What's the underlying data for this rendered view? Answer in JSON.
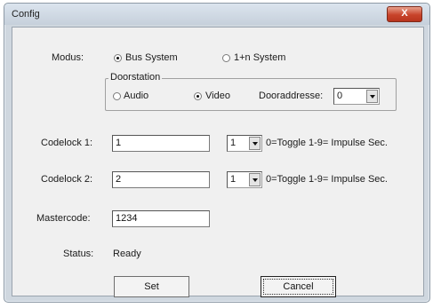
{
  "window": {
    "title": "Config",
    "close_label": "X"
  },
  "modus": {
    "label": "Modus:",
    "option_bus": "Bus System",
    "option_1n": "1+n System",
    "selected": "Bus System"
  },
  "doorstation": {
    "legend": "Doorstation",
    "option_audio": "Audio",
    "option_video": "Video",
    "selected": "Video",
    "address_label": "Dooraddresse:",
    "address_value": "0"
  },
  "codelock1": {
    "label": "Codelock 1:",
    "value": "1",
    "mode_value": "1",
    "hint": "0=Toggle  1-9= Impulse Sec."
  },
  "codelock2": {
    "label": "Codelock 2:",
    "value": "2",
    "mode_value": "1",
    "hint": "0=Toggle  1-9= Impulse Sec."
  },
  "mastercode": {
    "label": "Mastercode:",
    "value": "1234"
  },
  "status": {
    "label": "Status:",
    "value": "Ready"
  },
  "buttons": {
    "set": "Set",
    "cancel": "Cancel"
  }
}
